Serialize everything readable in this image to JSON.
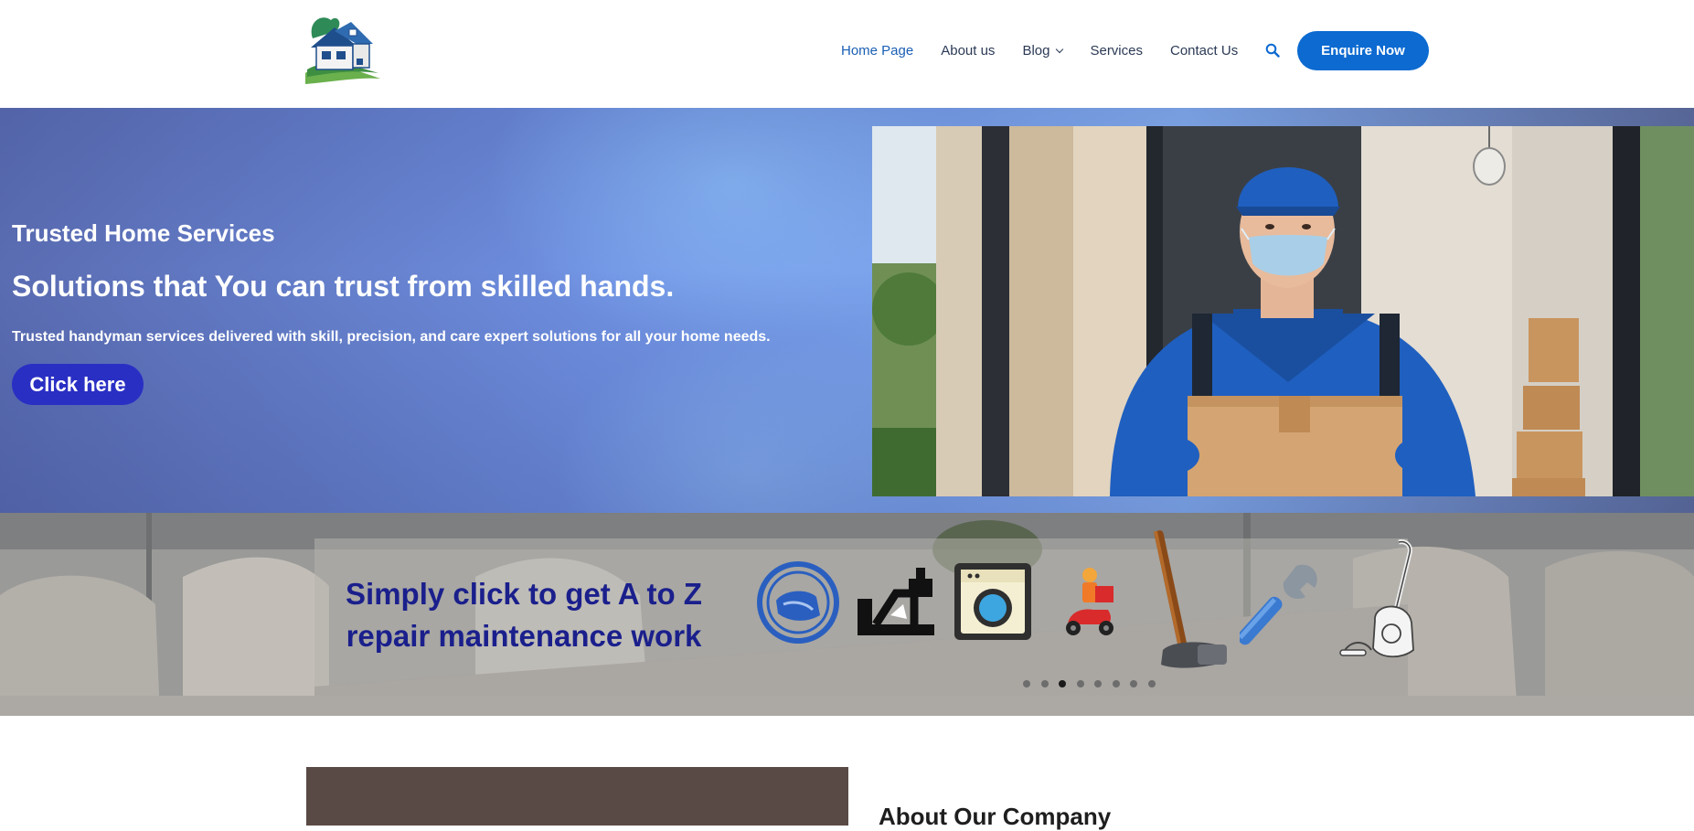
{
  "header": {
    "logo_icon": "house-logo-icon",
    "nav": {
      "home": "Home Page",
      "about": "About us",
      "blog": "Blog",
      "services": "Services",
      "contact": "Contact Us"
    },
    "search_icon": "search-icon",
    "enquire_label": "Enquire Now"
  },
  "hero": {
    "subtitle": "Trusted Home Services",
    "title": "Solutions that You can trust from skilled hands.",
    "description": "Trusted handyman services delivered with skill, precision, and care expert solutions for all your home needs.",
    "button_label": "Click here",
    "photo": "delivery-worker-with-box-photo"
  },
  "banner": {
    "text": "Simply click to get A to Z repair maintenance work",
    "icons": [
      "cleaning-icon",
      "plumbing-icon",
      "washing-machine-icon",
      "delivery-scooter-icon",
      "hammer-icon",
      "wrench-icon",
      "vacuum-cleaner-icon"
    ],
    "slides_total": 8,
    "active_slide": 3
  },
  "about": {
    "title": "About Our Company"
  },
  "colors": {
    "brand_blue": "#0c6ad1",
    "hero_button": "#2a2fc4",
    "banner_text": "#1a1f8c",
    "nav_active": "#1a5fb4"
  }
}
